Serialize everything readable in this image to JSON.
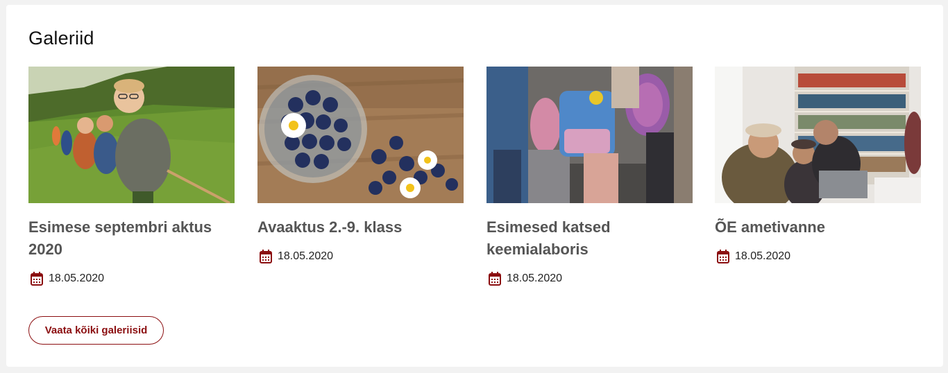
{
  "section": {
    "title": "Galeriid"
  },
  "galleries": [
    {
      "title": "Esimese septembri aktus 2020",
      "date": "18.05.2020",
      "image": "children-tug-of-war-photo"
    },
    {
      "title": "Avaaktus 2.-9. klass",
      "date": "18.05.2020",
      "image": "blueberries-daisies-bowl-photo"
    },
    {
      "title": "Esimesed katsed keemialaboris",
      "date": "18.05.2020",
      "image": "students-backpacks-photo"
    },
    {
      "title": "ÕE ametivanne",
      "date": "18.05.2020",
      "image": "students-library-laptop-photo"
    }
  ],
  "actions": {
    "view_all_label": "Vaata kõiki galeriisid"
  },
  "colors": {
    "accent": "#8b0e10",
    "card_title": "#555555",
    "background": "#f2f2f2"
  }
}
